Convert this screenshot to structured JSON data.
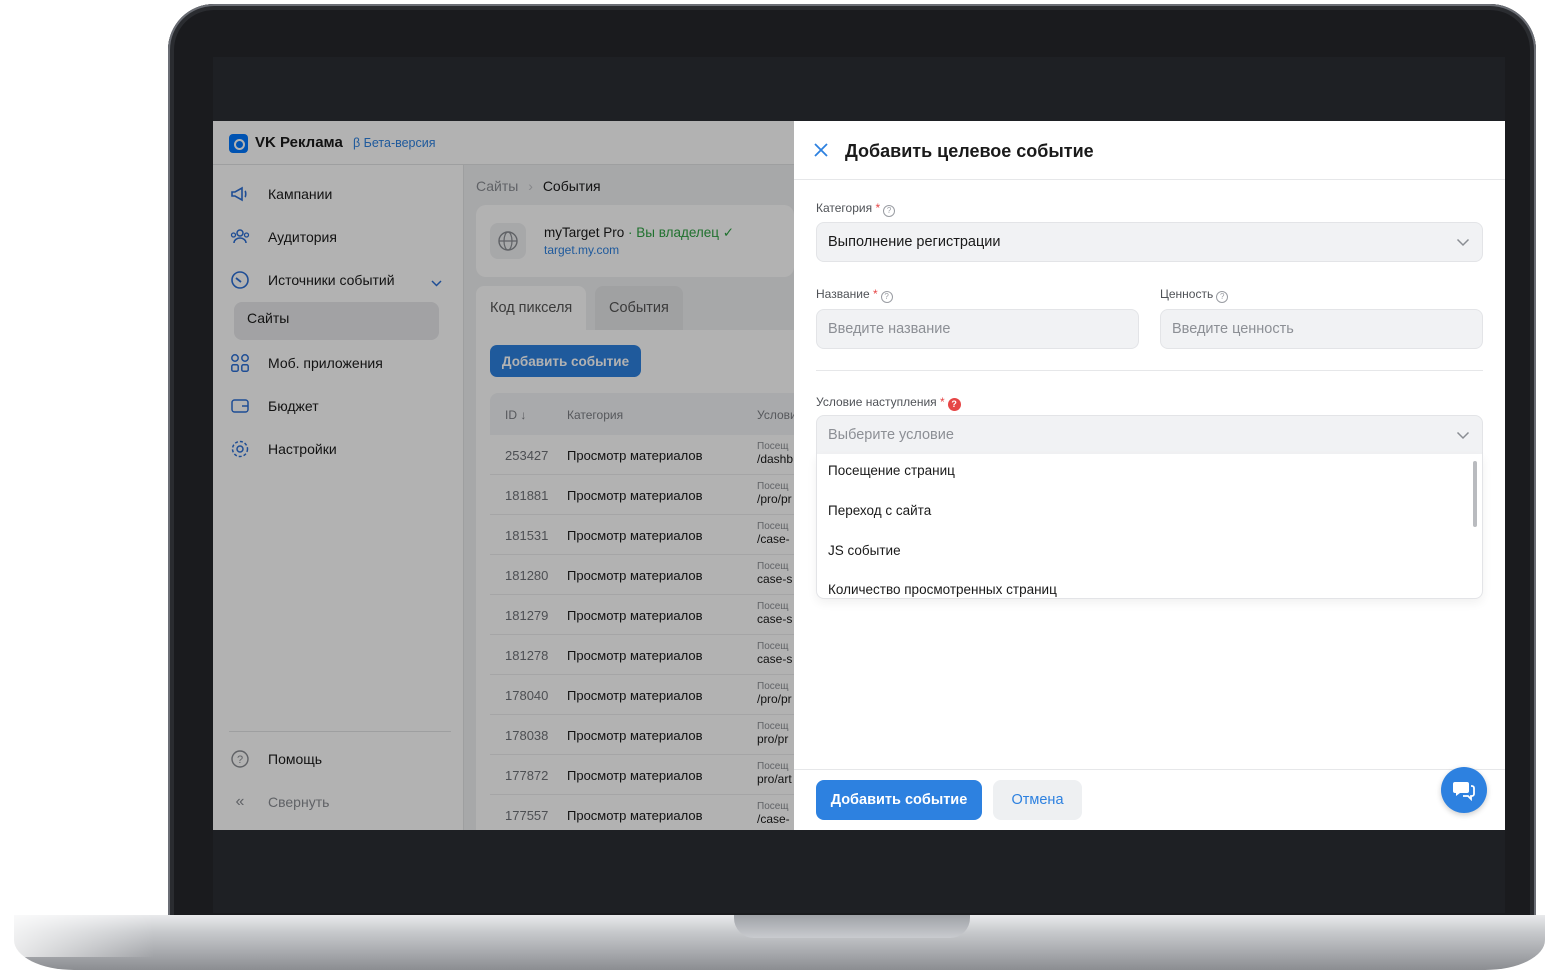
{
  "app": {
    "brand": "VK Реклама",
    "beta": "β Бета-версия"
  },
  "sidebar": {
    "items": [
      {
        "label": "Кампании",
        "icon": "megaphone-icon"
      },
      {
        "label": "Аудитория",
        "icon": "users-icon"
      },
      {
        "label": "Источники событий",
        "icon": "gauge-icon"
      },
      {
        "label": "Моб. приложения",
        "icon": "apps-icon"
      },
      {
        "label": "Бюджет",
        "icon": "wallet-icon"
      },
      {
        "label": "Настройки",
        "icon": "gear-icon"
      }
    ],
    "sub_item": "Сайты",
    "help": "Помощь",
    "collapse": "Свернуть"
  },
  "breadcrumb": {
    "parent": "Сайты",
    "separator": "›",
    "current": "События"
  },
  "site": {
    "name": "myTarget Pro",
    "owner": " · Вы владелец ✓",
    "url": "target.my.com"
  },
  "tabs": [
    "Код пикселя",
    "События"
  ],
  "add_event_small": "Добавить событие",
  "table": {
    "headers": {
      "id": "ID ↓",
      "category": "Категория",
      "condition": "Услови"
    },
    "rows": [
      {
        "id": "253427",
        "category": "Просмотр материалов",
        "cond_top": "Посещ",
        "cond": "/dashb"
      },
      {
        "id": "181881",
        "category": "Просмотр материалов",
        "cond_top": "Посещ",
        "cond": "/pro/pr"
      },
      {
        "id": "181531",
        "category": "Просмотр материалов",
        "cond_top": "Посещ",
        "cond": "/case-"
      },
      {
        "id": "181280",
        "category": "Просмотр материалов",
        "cond_top": "Посещ",
        "cond": "case-s"
      },
      {
        "id": "181279",
        "category": "Просмотр материалов",
        "cond_top": "Посещ",
        "cond": "case-s"
      },
      {
        "id": "181278",
        "category": "Просмотр материалов",
        "cond_top": "Посещ",
        "cond": "case-s"
      },
      {
        "id": "178040",
        "category": "Просмотр материалов",
        "cond_top": "Посещ",
        "cond": "/pro/pr"
      },
      {
        "id": "178038",
        "category": "Просмотр материалов",
        "cond_top": "Посещ",
        "cond": "pro/pr"
      },
      {
        "id": "177872",
        "category": "Просмотр материалов",
        "cond_top": "Посещ",
        "cond": "pro/art"
      },
      {
        "id": "177557",
        "category": "Просмотр материалов",
        "cond_top": "Посещ",
        "cond": "/case-"
      }
    ]
  },
  "modal": {
    "title": "Добавить целевое событие",
    "category_label": "Категория",
    "category_value": "Выполнение регистрации",
    "name_label": "Название",
    "name_placeholder": "Введите название",
    "value_label": "Ценность",
    "value_placeholder": "Введите ценность",
    "condition_label": "Условие наступления",
    "condition_placeholder": "Выберите условие",
    "condition_options": [
      "Посещение страниц",
      "Переход с сайта",
      "JS событие",
      "Количество просмотренных страниц"
    ],
    "submit": "Добавить событие",
    "cancel": "Отмена"
  },
  "colors": {
    "accent": "#2d81e0",
    "required": "#e64646",
    "owner_green": "#2fa344"
  }
}
